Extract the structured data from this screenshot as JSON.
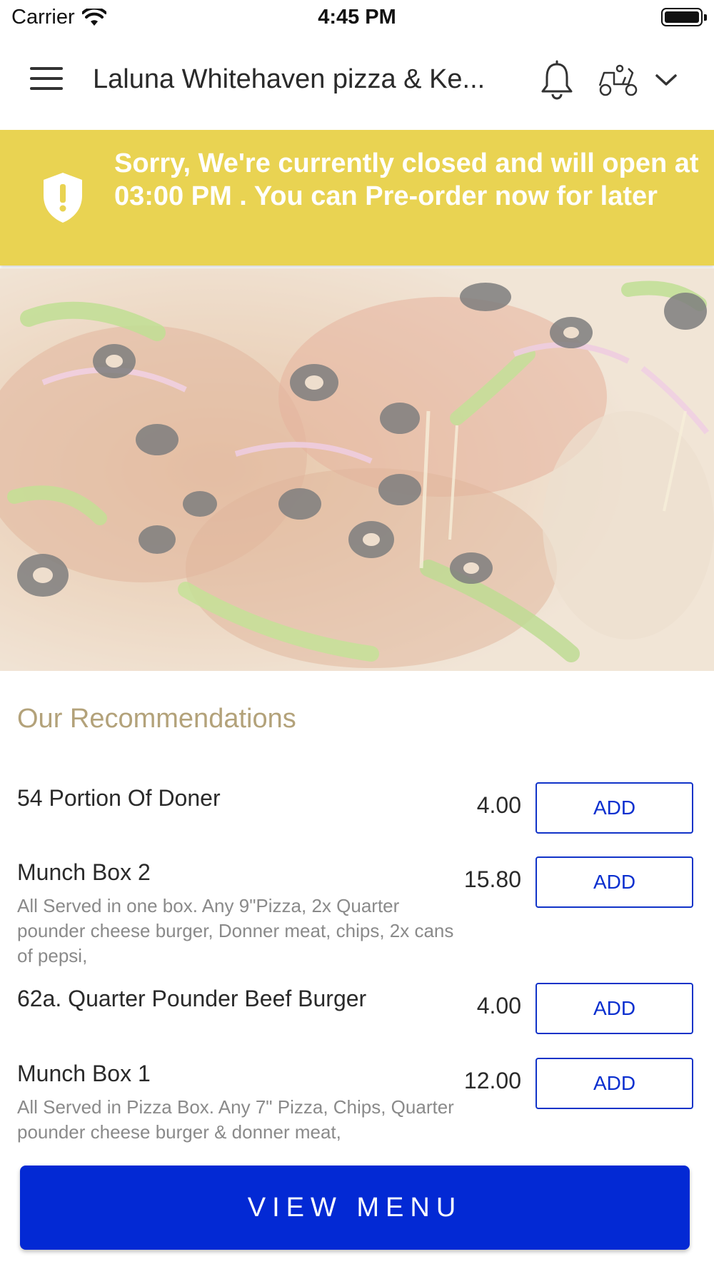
{
  "status_bar": {
    "carrier": "Carrier",
    "time": "4:45 PM"
  },
  "header": {
    "title": "Laluna Whitehaven pizza & Ke...",
    "icons": [
      "menu-icon",
      "bell-icon",
      "scooter-icon",
      "chevron-down-icon"
    ]
  },
  "banner": {
    "message": "Sorry, We're currently closed and will open at 03:00 PM . You can Pre-order now for later",
    "background": "#e9d352",
    "icon": "shield-alert-icon"
  },
  "recommendations": {
    "title": "Our Recommendations",
    "items": [
      {
        "name": "54 Portion Of Doner",
        "description": "",
        "price": "4.00",
        "button": "ADD"
      },
      {
        "name": "Munch Box 2",
        "description": "All Served in one box. Any 9\"Pizza, 2x Quarter pounder cheese burger, Donner meat, chips, 2x cans of pepsi,",
        "price": "15.80",
        "button": "ADD"
      },
      {
        "name": "62a. Quarter Pounder Beef Burger",
        "description": "",
        "price": "4.00",
        "button": "ADD"
      },
      {
        "name": "Munch Box 1",
        "description": "All Served in Pizza Box. Any 7\" Pizza, Chips, Quarter pounder cheese burger & donner meat,",
        "price": "12.00",
        "button": "ADD"
      }
    ]
  },
  "footer": {
    "view_menu": "VIEW MENU",
    "accent": "#0329d4"
  }
}
